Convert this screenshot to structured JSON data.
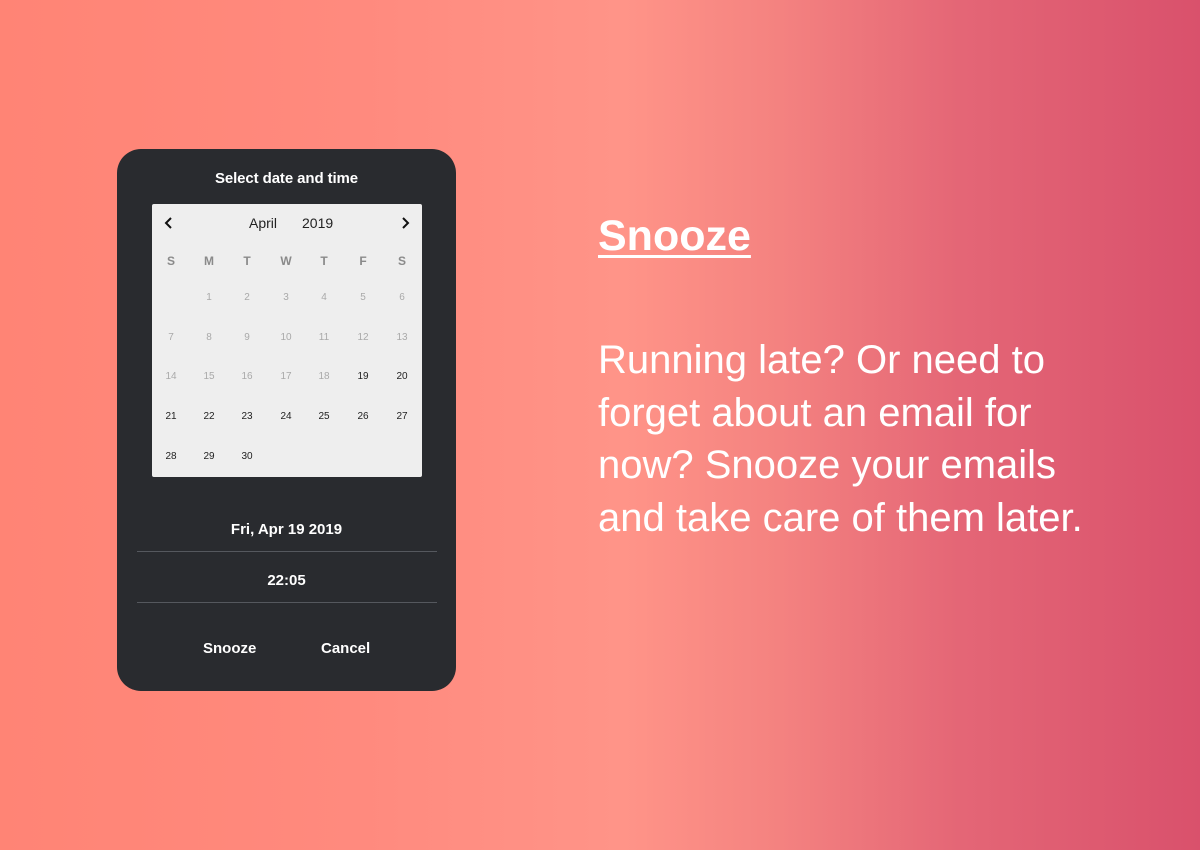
{
  "dialog": {
    "title": "Select date and time",
    "calendar": {
      "month": "April",
      "year": "2019",
      "prev_icon": "chevron-left-icon",
      "next_icon": "chevron-right-icon",
      "weekdays": [
        "S",
        "M",
        "T",
        "W",
        "T",
        "F",
        "S"
      ],
      "weeks": [
        [
          "",
          "1",
          "2",
          "3",
          "4",
          "5",
          "6"
        ],
        [
          "7",
          "8",
          "9",
          "10",
          "11",
          "12",
          "13"
        ],
        [
          "14",
          "15",
          "16",
          "17",
          "18",
          "19",
          "20"
        ],
        [
          "21",
          "22",
          "23",
          "24",
          "25",
          "26",
          "27"
        ],
        [
          "28",
          "29",
          "30",
          "",
          "",
          "",
          ""
        ]
      ],
      "first_available_day": 19
    },
    "selected_date": "Fri, Apr 19 2019",
    "selected_time": "22:05",
    "snooze_label": "Snooze",
    "cancel_label": "Cancel"
  },
  "feature": {
    "title": "Snooze",
    "description": "Running late? Or need to forget about an email for now? Snooze your emails and take care of them later."
  },
  "colors": {
    "dialog_bg": "#292b2f",
    "calendar_bg": "#eeeeee",
    "gradient_left": "#ff8475",
    "gradient_right": "#d9516c"
  }
}
